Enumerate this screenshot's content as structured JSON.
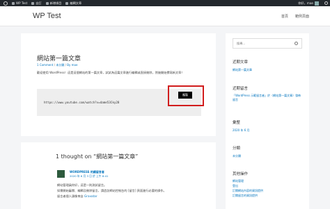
{
  "admin_bar": {
    "site": "WP Test",
    "customize": "自訂",
    "new": "新增項目",
    "edit": "編輯文章",
    "greeting": "你好，mae"
  },
  "header": {
    "site_title": "WP Test",
    "nav": [
      "首頁",
      "範例頁面"
    ]
  },
  "article": {
    "title": "網站第一篇文章",
    "meta": {
      "comments": "1 Comment",
      "category": "未分類",
      "author": "By mae"
    },
    "body": "歡迎使用 WordPress！這是這個網站的第一篇文章，試試為這篇文章進行編輯或直接刪除，然後開始撰寫新文章！",
    "code_url": "https://www.youtube.com/watch?v=dame53Cky28",
    "copy_label": "複製"
  },
  "comments": {
    "title": "1 thought on “網站第一篇文章”",
    "author": "WORDPRESS 的顧留言者",
    "date": "2020 年 6 月 3 日 於 上午 8:41",
    "text_lines": [
      "網站管理員你好，這是一則測試留言。",
      "如需開始審閱、編輯及刪除留言，請造訪網站控制台的 [留言] 頁面進行必要的操作。",
      "留言者個人頭像來自 "
    ],
    "gravatar": "Gravatar"
  },
  "sidebar": {
    "search_placeholder": "搜尋...",
    "recent_posts": {
      "heading": "近期文章",
      "items": [
        "網站第一篇文章"
      ]
    },
    "recent_comments": {
      "heading": "近期留言",
      "text": "「WordPress 示範留言者」於〈網站第一篇文章〉發佈留言"
    },
    "archives": {
      "heading": "彙整",
      "items": [
        "2020 年 6 月"
      ]
    },
    "categories": {
      "heading": "分類",
      "items": [
        "未分類"
      ]
    },
    "meta": {
      "heading": "其他操作",
      "items": [
        "網站管理",
        "登出",
        "訂閱網站內容的資訊提供",
        "訂閱留言的資訊提供"
      ]
    }
  }
}
